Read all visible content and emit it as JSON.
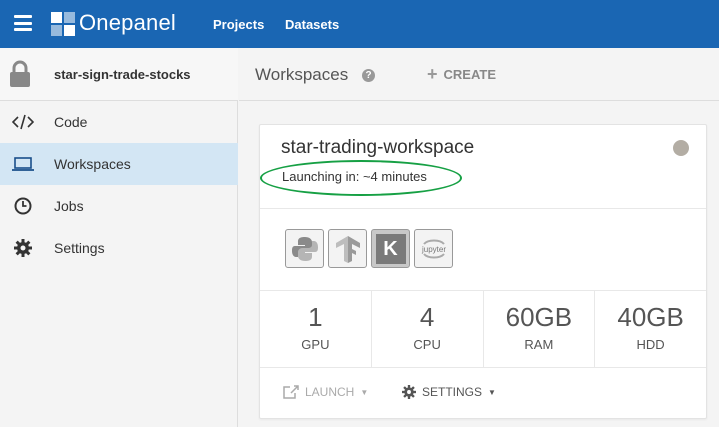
{
  "app": {
    "name": "Onepanel"
  },
  "nav": {
    "projects": "Projects",
    "datasets": "Datasets"
  },
  "sidebar": {
    "project_name": "star-sign-trade-stocks",
    "items": [
      {
        "label": "Code",
        "icon": "code-icon",
        "active": false
      },
      {
        "label": "Workspaces",
        "icon": "laptop-icon",
        "active": true
      },
      {
        "label": "Jobs",
        "icon": "clock-icon",
        "active": false
      },
      {
        "label": "Settings",
        "icon": "gear-icon",
        "active": false
      }
    ]
  },
  "main": {
    "title": "Workspaces",
    "help": "?",
    "create_label": "CREATE"
  },
  "workspace": {
    "name": "star-trading-workspace",
    "status_text": "Launching in: ~4 minutes",
    "status_color": "#b3ada4",
    "frameworks": [
      "python-icon",
      "tensorflow-icon",
      "keras-icon",
      "jupyter-icon"
    ],
    "keras_letter": "K",
    "jupyter_label": "jupyter",
    "specs": [
      {
        "value": "1",
        "label": "GPU"
      },
      {
        "value": "4",
        "label": "CPU"
      },
      {
        "value": "60GB",
        "label": "RAM"
      },
      {
        "value": "40GB",
        "label": "HDD"
      }
    ],
    "launch_label": "LAUNCH",
    "settings_label": "SETTINGS"
  },
  "colors": {
    "topbar": "#1a66b3",
    "active_item": "#d3e6f4",
    "highlight": "#16a044"
  }
}
